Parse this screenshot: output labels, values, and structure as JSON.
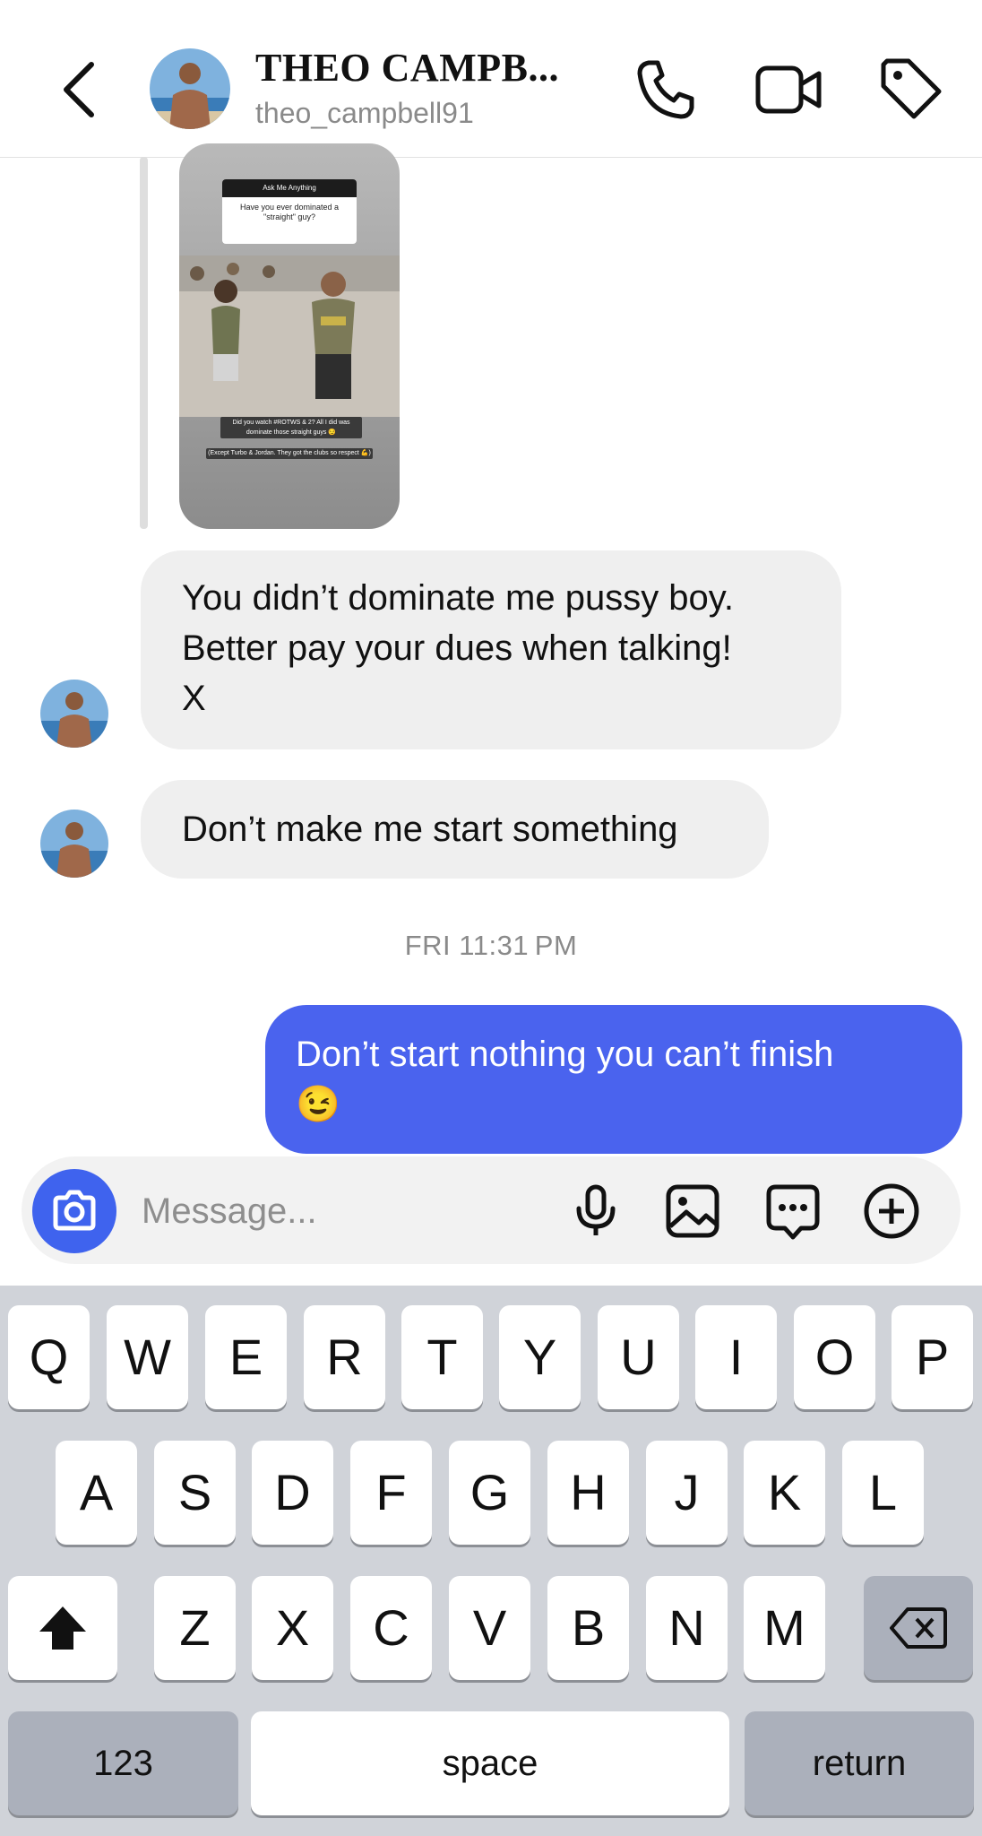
{
  "header": {
    "name": "THEO CAMPB...",
    "username": "theo_campbell91"
  },
  "story": {
    "question_title": "Ask Me Anything",
    "question_text": "Have you ever dominated a \"straight\" guy?",
    "caption_1": "Did you watch #ROTWS & 2? All I did was dominate those straight guys 😏",
    "caption_2": "(Except Turbo & Jordan. They got the clubs so respect 💪)"
  },
  "messages": {
    "msg1_line1": "You didn’t dominate me pussy boy.",
    "msg1_line2": "Better pay your dues when talking!",
    "msg1_line3": "X",
    "msg2": "Don’t make me start something",
    "timestamp": "FRI 11:31 PM",
    "msg3_line1": "Don’t start nothing you can’t finish",
    "msg3_line2": "😉"
  },
  "composer": {
    "placeholder": "Message..."
  },
  "keyboard": {
    "row1": [
      "Q",
      "W",
      "E",
      "R",
      "T",
      "Y",
      "U",
      "I",
      "O",
      "P"
    ],
    "row2": [
      "A",
      "S",
      "D",
      "F",
      "G",
      "H",
      "J",
      "K",
      "L"
    ],
    "row3": [
      "Z",
      "X",
      "C",
      "V",
      "B",
      "N",
      "M"
    ],
    "numbers_label": "123",
    "space_label": "space",
    "return_label": "return"
  },
  "colors": {
    "accent": "#4a63ee",
    "incoming_bubble": "#efefef",
    "keyboard_bg": "#d0d3d9"
  },
  "icons": [
    "back-icon",
    "phone-icon",
    "video-icon",
    "tag-icon",
    "camera-icon",
    "microphone-icon",
    "gallery-icon",
    "sticker-icon",
    "plus-icon",
    "shift-icon",
    "backspace-icon"
  ]
}
